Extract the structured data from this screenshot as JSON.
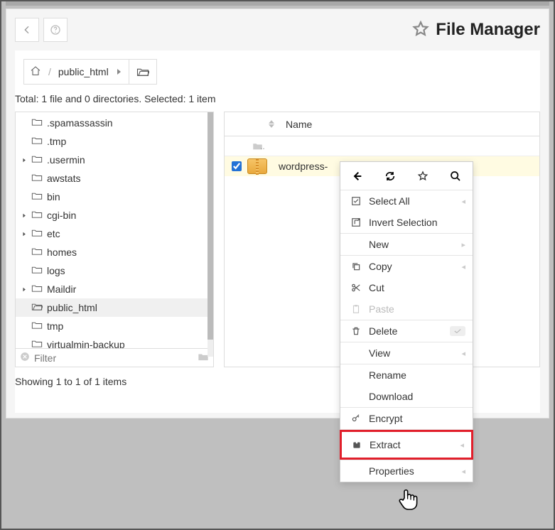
{
  "header": {
    "title": "File Manager"
  },
  "breadcrumb": {
    "item": "public_html"
  },
  "status": "Total: 1 file and 0 directories. Selected: 1 item",
  "tree": {
    "items": [
      {
        "label": ".spamassassin",
        "expandable": false
      },
      {
        "label": ".tmp",
        "expandable": false
      },
      {
        "label": ".usermin",
        "expandable": true
      },
      {
        "label": "awstats",
        "expandable": false
      },
      {
        "label": "bin",
        "expandable": false
      },
      {
        "label": "cgi-bin",
        "expandable": true
      },
      {
        "label": "etc",
        "expandable": true
      },
      {
        "label": "homes",
        "expandable": false
      },
      {
        "label": "logs",
        "expandable": false
      },
      {
        "label": "Maildir",
        "expandable": true
      },
      {
        "label": "public_html",
        "expandable": false,
        "active": true
      },
      {
        "label": "tmp",
        "expandable": false
      },
      {
        "label": "virtualmin-backup",
        "expandable": false
      }
    ],
    "filter_placeholder": "Filter"
  },
  "table": {
    "name_header": "Name",
    "parent": "..",
    "rows": [
      {
        "name": "wordpress-",
        "selected": true
      }
    ]
  },
  "showing": "Showing 1 to 1 of 1 items",
  "ctx": {
    "select_all": "Select All",
    "invert": "Invert Selection",
    "new": "New",
    "copy": "Copy",
    "cut": "Cut",
    "paste": "Paste",
    "delete": "Delete",
    "view": "View",
    "rename": "Rename",
    "download": "Download",
    "encrypt": "Encrypt",
    "extract": "Extract",
    "properties": "Properties"
  }
}
